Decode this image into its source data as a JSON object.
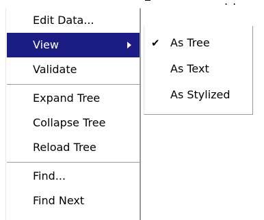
{
  "background_fragment": {
    "dots": ". ."
  },
  "context_menu": {
    "items": [
      {
        "label": "Edit Data..."
      },
      {
        "label": "View",
        "has_submenu": true,
        "selected": true
      },
      {
        "label": "Validate"
      },
      {
        "label": "Expand Tree"
      },
      {
        "label": "Collapse Tree"
      },
      {
        "label": "Reload Tree"
      },
      {
        "label": "Find..."
      },
      {
        "label": "Find Next"
      }
    ],
    "selected_background": "#1c1c85",
    "selected_text_color": "#ffffff"
  },
  "view_submenu": {
    "items": [
      {
        "label": "As Tree",
        "checked": true,
        "check_glyph": "✔"
      },
      {
        "label": "As Text",
        "checked": false
      },
      {
        "label": "As Stylized",
        "checked": false
      }
    ]
  },
  "icons": {
    "submenu_arrow": "chevron-right-icon",
    "check": "checkmark-icon"
  }
}
